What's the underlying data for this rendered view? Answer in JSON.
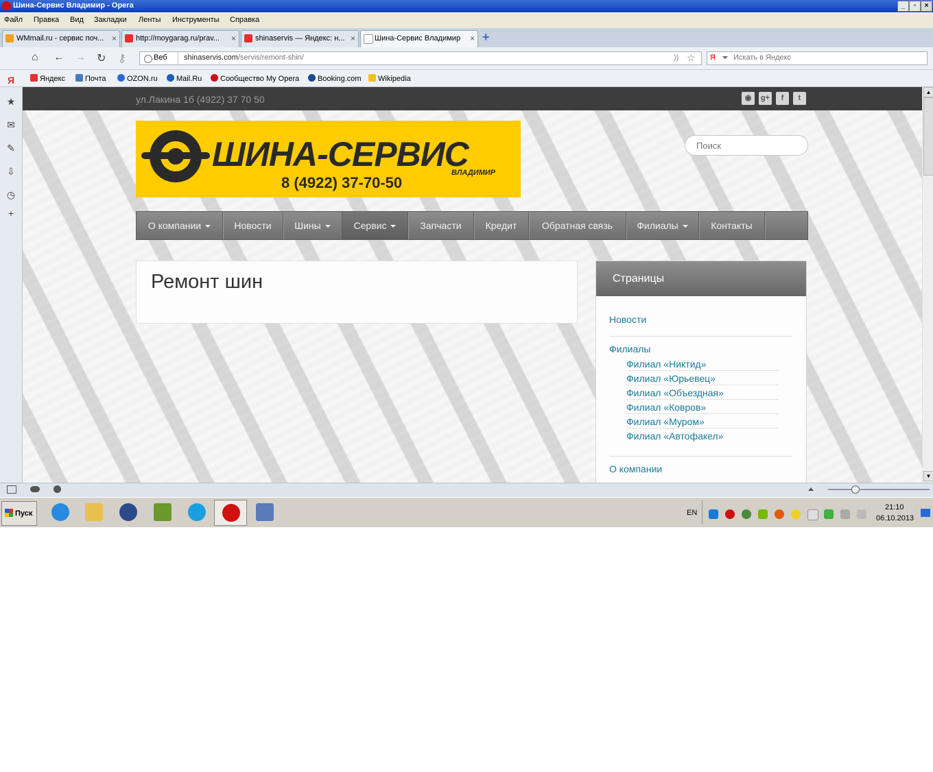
{
  "window": {
    "title": "Шина-Сервис Владимир - Opera",
    "controls": [
      "_",
      "▫",
      "×"
    ]
  },
  "menubar": [
    "Файл",
    "Правка",
    "Вид",
    "Закладки",
    "Ленты",
    "Инструменты",
    "Справка"
  ],
  "tabs": [
    {
      "label": "WMmail.ru - сервис поч...",
      "color": "#f0a020"
    },
    {
      "label": "http://moygarag.ru/prav...",
      "color": "#e63030"
    },
    {
      "label": "shinaservis — Яндекс: н...",
      "color": "#e63030"
    },
    {
      "label": "Шина-Сервис Владимир",
      "color": "#ffffff"
    }
  ],
  "tab_close": "×",
  "tab_add": "+",
  "addressbar": {
    "nav": [
      "⌂",
      "←",
      "→",
      "↻",
      "⚷"
    ],
    "web_label": "Веб",
    "domain": "shinaservis.com",
    "path": "/servis/remont-shin/",
    "feed_star": "☆",
    "search_placeholder": "Искать в Яндекс",
    "search_engine": "Я"
  },
  "bookmarks": [
    {
      "label": "Яндекс",
      "color": "#e63030"
    },
    {
      "label": "Почта",
      "color": "#4a78c0"
    },
    {
      "label": "OZON.ru",
      "color": "#2a6ad8"
    },
    {
      "label": "Mail.Ru",
      "color": "#1660b8"
    },
    {
      "label": "Сообщество My Opera",
      "color": "#d01010"
    },
    {
      "label": "Booking.com",
      "color": "#1a4b8e"
    },
    {
      "label": "Wikipedia",
      "color": "#f0c020"
    }
  ],
  "panel_icons": [
    "Я",
    "★",
    "✉",
    "✎",
    "⇩",
    "◷",
    "+"
  ],
  "site": {
    "address": "ул.Лакина 1б (4922) 37 70 50",
    "social": [
      "◉",
      "g+",
      "f",
      "t"
    ],
    "logo": {
      "brand": "ШИНА-СЕРВИС",
      "city": "ВЛАДИМИР",
      "phone": "8 (4922) 37-70-50",
      "accent": "#ffcc00"
    },
    "search_placeholder": "Поиск",
    "nav": [
      {
        "label": "О компании",
        "dropdown": true
      },
      {
        "label": "Новости",
        "dropdown": false
      },
      {
        "label": "Шины",
        "dropdown": true
      },
      {
        "label": "Сервис",
        "dropdown": true,
        "active": true
      },
      {
        "label": "Запчасти",
        "dropdown": false
      },
      {
        "label": "Кредит",
        "dropdown": false
      },
      {
        "label": "Обратная связь",
        "dropdown": false
      },
      {
        "label": "Филиалы",
        "dropdown": true
      },
      {
        "label": "Контакты",
        "dropdown": false
      }
    ],
    "page_title": "Ремонт шин",
    "sidebar": {
      "title": "Страницы",
      "items": [
        "Новости",
        "Филиалы",
        "О компании"
      ],
      "branches": [
        "Филиал «Никтид»",
        "Филиал «Юрьевец»",
        "Филиал «Объездная»",
        "Филиал «Ковров»",
        "Филиал «Муром»",
        "Филиал «Автофакел»"
      ]
    }
  },
  "taskbar": {
    "start_label": "Пуск",
    "apps": [
      {
        "name": "ie",
        "color": "#2a8ae0"
      },
      {
        "name": "explorer",
        "color": "#e8c050"
      },
      {
        "name": "hp",
        "color": "#2a4a8a"
      },
      {
        "name": "green",
        "color": "#6a9a2a"
      },
      {
        "name": "skype",
        "color": "#1aa0e0"
      },
      {
        "name": "opera",
        "color": "#d01010"
      },
      {
        "name": "doc",
        "color": "#5a7ab8"
      }
    ],
    "lang": "EN",
    "time": "21:10",
    "date": "06.10.2013"
  }
}
